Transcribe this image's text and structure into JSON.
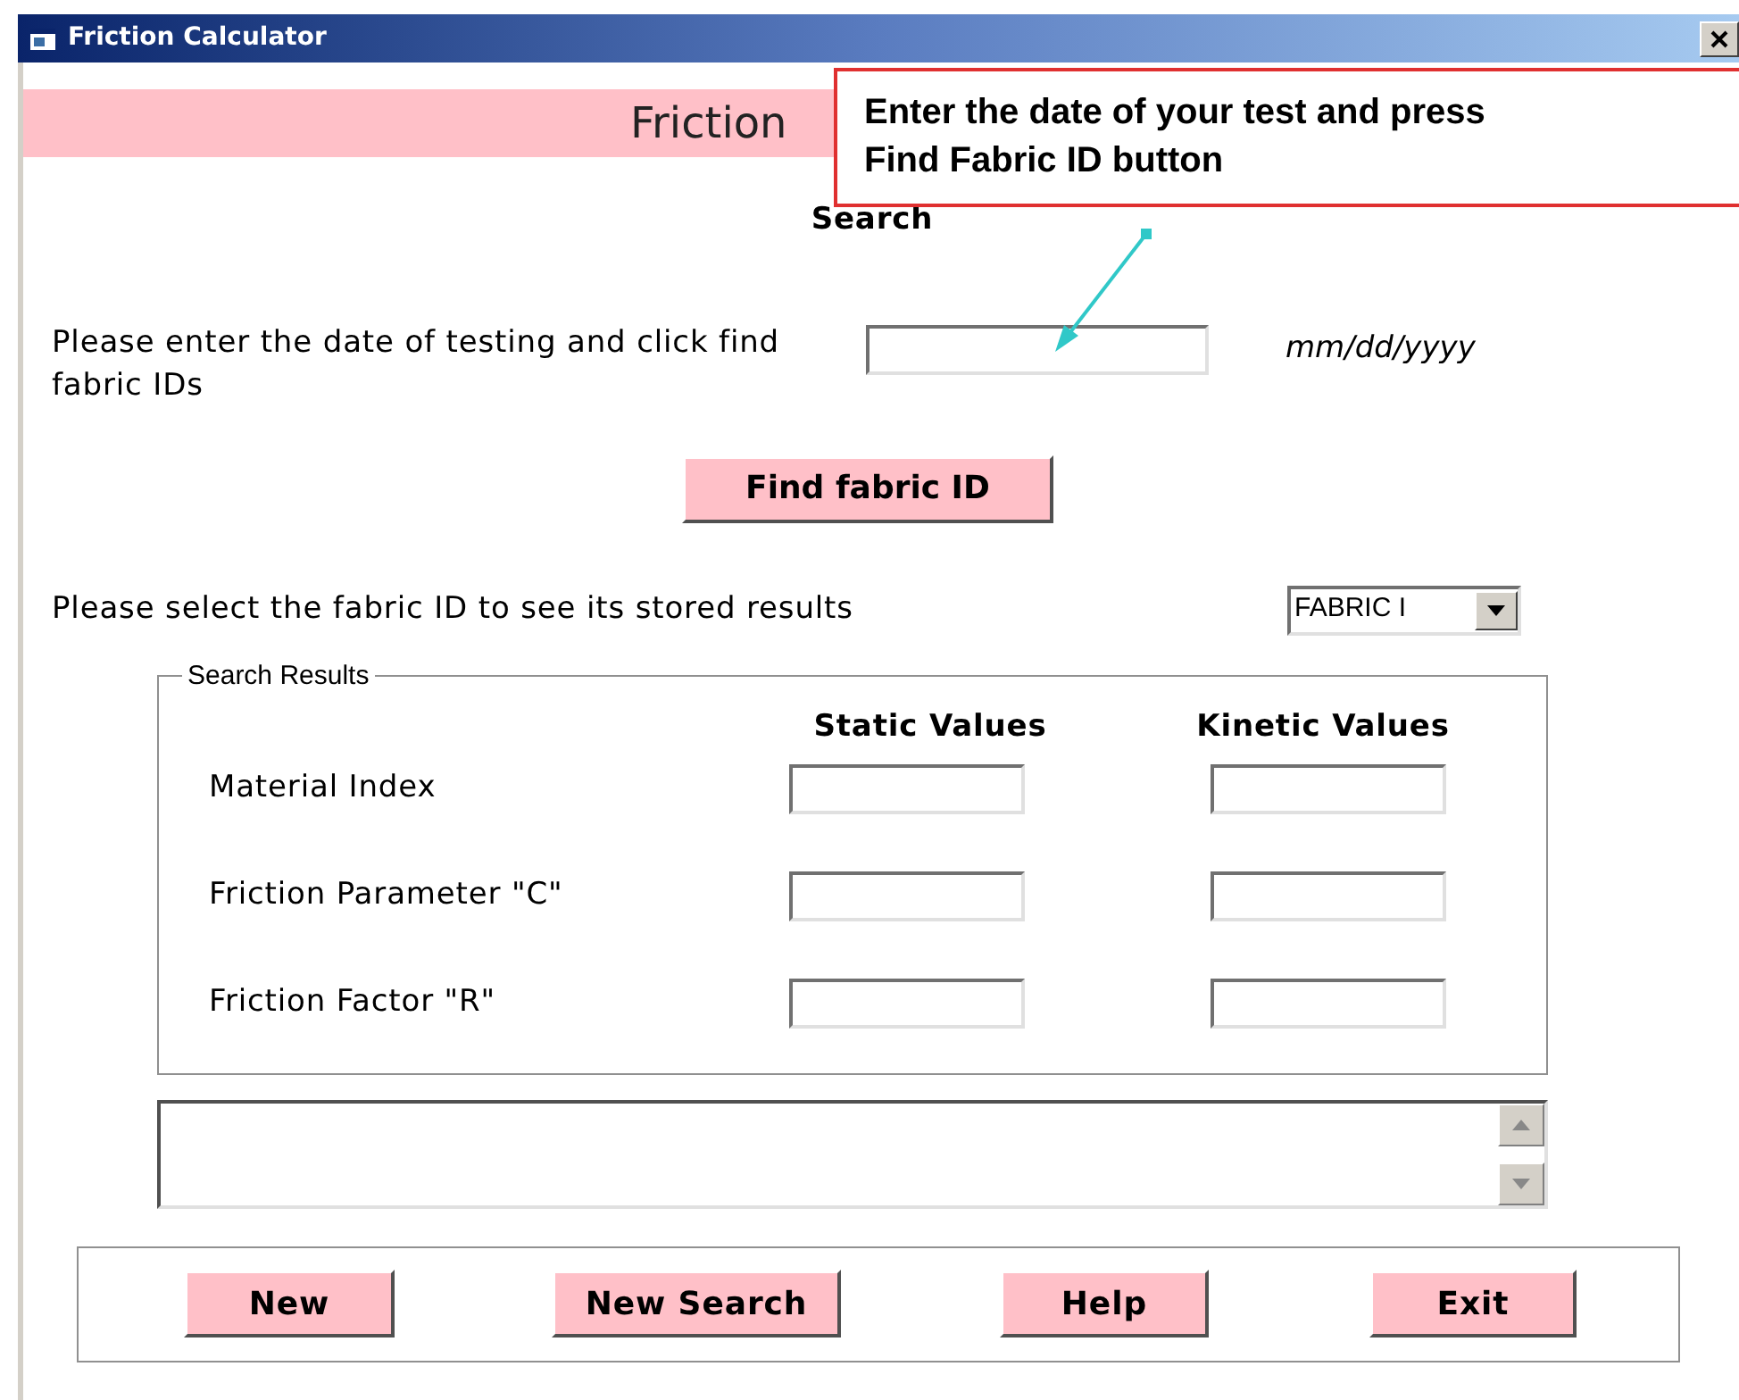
{
  "window": {
    "title": "Friction Calculator"
  },
  "header": {
    "title": "Friction"
  },
  "callout": {
    "text": "Enter the date of your test and press Find Fabric ID button"
  },
  "search": {
    "heading": "Search",
    "prompt": "Please enter the date of testing and click find fabric IDs",
    "format_hint": "mm/dd/yyyy",
    "button": "Find fabric ID"
  },
  "fabric_select": {
    "prompt": "Please select the fabric ID to see its stored results",
    "value": "FABRIC I"
  },
  "results": {
    "legend": "Search Results",
    "columns": [
      "Static Values",
      "Kinetic Values"
    ],
    "rows": [
      {
        "label": "Material Index"
      },
      {
        "label": "Friction Parameter \"C\""
      },
      {
        "label": "Friction Factor \"R\""
      }
    ]
  },
  "buttons": [
    "New",
    "New Search",
    "Help",
    "Exit"
  ]
}
